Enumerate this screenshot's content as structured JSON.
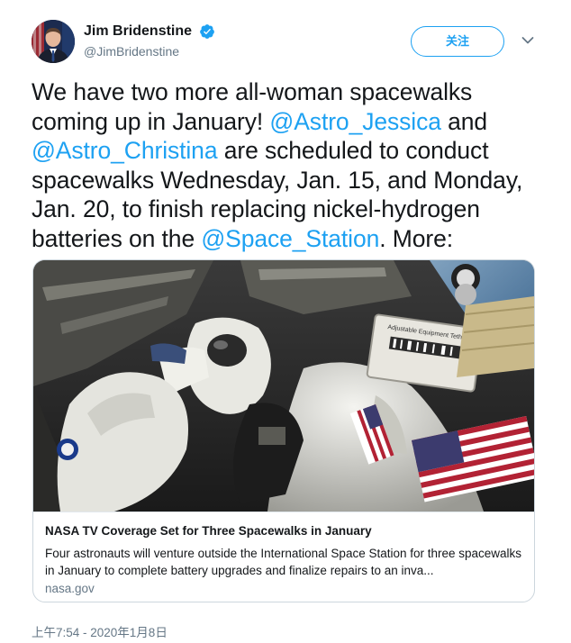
{
  "author": {
    "display_name": "Jim Bridenstine",
    "handle": "@JimBridenstine",
    "verified": true
  },
  "follow_button": {
    "label": "关注"
  },
  "tweet": {
    "segments": [
      {
        "text": "We have two more all-woman spacewalks coming up in January! ",
        "type": "text"
      },
      {
        "text": "@Astro_Jessica",
        "type": "mention"
      },
      {
        "text": " and ",
        "type": "text"
      },
      {
        "text": "@Astro_Christina",
        "type": "mention"
      },
      {
        "text": " are scheduled to conduct spacewalks Wednesday, Jan. 15, and Monday, Jan. 20, to finish replacing nickel-hydrogen batteries on the ",
        "type": "text"
      },
      {
        "text": "@Space_Station",
        "type": "mention"
      },
      {
        "text": ". More:",
        "type": "text"
      }
    ]
  },
  "card": {
    "title": "NASA TV Coverage Set for Three Spacewalks in January",
    "description": "Four astronauts will venture outside the International Space Station for three spacewalks in January to complete battery upgrades and finalize repairs to an inva...",
    "domain": "nasa.gov",
    "image_label_text": "Adjustable Equipment Tether"
  },
  "timestamp": "上午7:54 - 2020年1月8日",
  "colors": {
    "accent": "#1da1f2",
    "text": "#14171a",
    "secondary": "#657786",
    "border": "#ccd6dd"
  }
}
